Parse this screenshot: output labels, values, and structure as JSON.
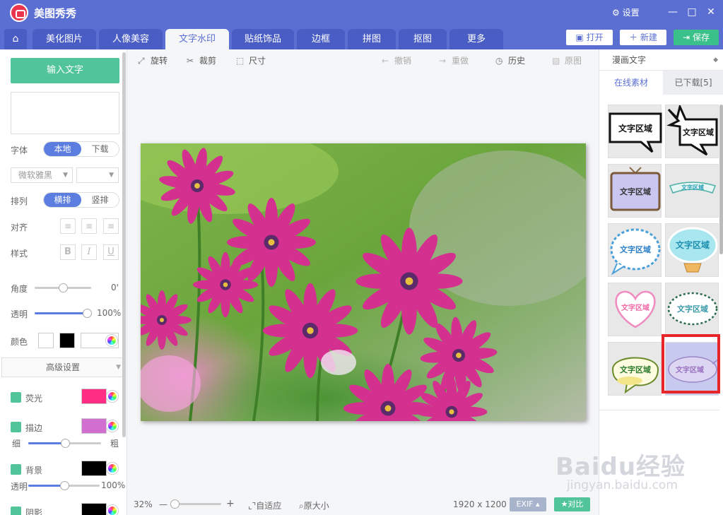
{
  "app": {
    "title": "美图秀秀",
    "settings_label": "设置",
    "win_min": "—",
    "win_max": "□",
    "win_close": "✕"
  },
  "menu": {
    "home_icon": "home-icon",
    "tabs": [
      {
        "label": "美化图片"
      },
      {
        "label": "人像美容"
      },
      {
        "label": "文字水印"
      },
      {
        "label": "贴纸饰品"
      },
      {
        "label": "边框"
      },
      {
        "label": "拼图"
      },
      {
        "label": "抠图"
      },
      {
        "label": "更多"
      }
    ],
    "active_tab": "文字水印",
    "open_label": "打开",
    "new_label": "新建",
    "save_label": "保存"
  },
  "left": {
    "input_text_button": "输入文字",
    "font_label": "字体",
    "font_source": {
      "local": "本地",
      "download": "下载",
      "selected": "本地"
    },
    "font_family": "微软雅黑",
    "font_size": "",
    "arrange_label": "排列",
    "arrange": {
      "horizontal": "横排",
      "vertical": "竖排",
      "selected": "横排"
    },
    "align_label": "对齐",
    "style_label": "样式",
    "style_bold": "B",
    "style_italic": "I",
    "style_underline": "U",
    "angle_label": "角度",
    "angle_value": "0'",
    "angle_fraction": 0.5,
    "opacity_label": "透明",
    "opacity_value": "100%",
    "opacity_fraction": 1.0,
    "color_label": "颜色",
    "color_swatches": [
      "#ffffff",
      "#000000",
      "#ffffff"
    ],
    "advanced_label": "高级设置",
    "glow_label": "荧光",
    "glow_color": "#ff2d84",
    "stroke_label": "描边",
    "stroke_color": "#d36ed1",
    "thin_label": "细",
    "thick_label": "粗",
    "stroke_fraction": 0.5,
    "background_label": "背景",
    "background_color": "#000000",
    "bg_opacity_label": "透明",
    "bg_opacity_value": "100%",
    "bg_opacity_fraction": 0.5,
    "shadow_label": "阴影",
    "shadow_color": "#000000"
  },
  "toolbar": {
    "rotate": "旋转",
    "crop": "裁剪",
    "size": "尺寸",
    "undo": "撤销",
    "redo": "重做",
    "history": "历史",
    "original": "原图"
  },
  "status": {
    "zoom": "32%",
    "zoom_minus": "—",
    "zoom_plus": "+",
    "zoom_fraction": 0.08,
    "fit_label": "自适应",
    "actual_size_label": "原大小",
    "dimensions": "1920 x 1200",
    "exif_label": "EXIF",
    "compare_label": "对比"
  },
  "right": {
    "category": "漫画文字",
    "tab_online": "在线素材",
    "tab_downloaded": "已下载[5]",
    "tile_text": "文字区域",
    "tiles": [
      {
        "name": "speech-bubble-rect"
      },
      {
        "name": "speech-bubble-burst"
      },
      {
        "name": "hanging-sign"
      },
      {
        "name": "ribbon-banner"
      },
      {
        "name": "scalloped-bubble-blue"
      },
      {
        "name": "cloud-balloon-cyan"
      },
      {
        "name": "heart-bubble-pink"
      },
      {
        "name": "dotted-oval-green"
      },
      {
        "name": "bubble-yellow-green"
      },
      {
        "name": "oval-lavender-selected"
      }
    ],
    "selected_tile": 9
  },
  "watermark": {
    "brand": "Baidu经验",
    "url": "jingyan.baidu.com"
  }
}
